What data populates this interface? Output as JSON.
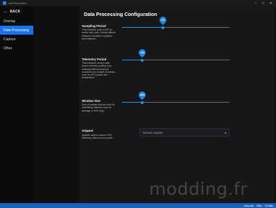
{
  "window": {
    "title": "Intel PresentMon",
    "minimize_glyph": "–",
    "maximize_glyph": "□",
    "close_glyph": "✕"
  },
  "sidebar": {
    "back_arrow": "←",
    "back_label": "BACK",
    "items": [
      {
        "label": "Overlay",
        "active": false
      },
      {
        "label": "Data Processing",
        "active": true
      },
      {
        "label": "Capture",
        "active": false
      },
      {
        "label": "Other",
        "active": false
      }
    ]
  },
  "page": {
    "title": "Data Processing Configuration"
  },
  "settings": {
    "sampling": {
      "title": "Sampling Period",
      "description": "Time between polls to API for metric data (ms). Directly affects temporal resolution of graphs and readouts.",
      "value": "100",
      "fraction": 0.38
    },
    "telemetry": {
      "title": "Telemetry Period",
      "description": "Time between service-side power telemetry polling (ms). Indirectly affects temporal resolution of a subset of metrics, such as GPU power and temperature.",
      "value": "100",
      "fraction": 0.19
    },
    "window": {
      "title": "Window Size",
      "description": "Size of sample window used for calculating statistics such as average or 99% (ms).",
      "value": "1000",
      "fraction": 0.19
    },
    "adapter": {
      "title": "Adapter",
      "description": "Adapter used to source GPU telemetry data such as power.",
      "selected": "Default adapter",
      "caret": "▾"
    }
  },
  "statusbar": {
    "items": [
      "Automatic",
      "50fps",
      "16.66fps"
    ]
  },
  "watermark": "modding.fr",
  "colors": {
    "accent": "#1e88e5",
    "nav_active": "#1a73e8",
    "statusbar": "#1565c0"
  }
}
